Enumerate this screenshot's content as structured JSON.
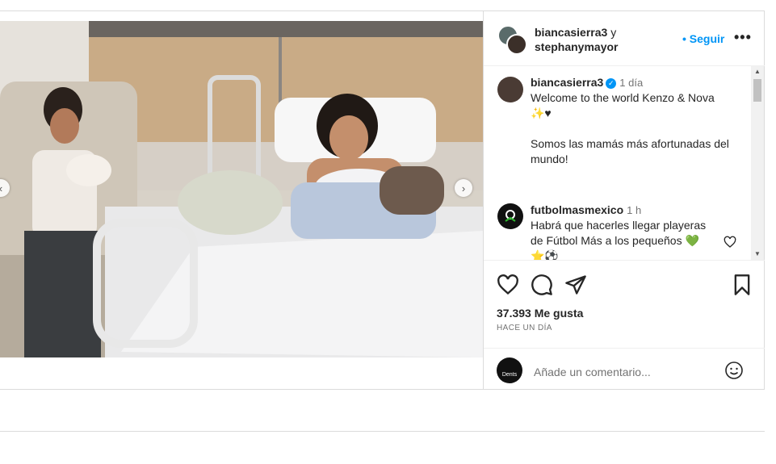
{
  "header": {
    "author1": "biancasierra3",
    "joiner": "y",
    "author2": "stephanymayor",
    "follow_label": "Seguir",
    "follow_dot": "•",
    "more_label": "•••"
  },
  "caption": {
    "user": "biancasierra3",
    "time": "1 día",
    "line1": "Welcome to the world Kenzo & Nova",
    "emoji1": "✨♥",
    "line2": "Somos las mamás más afortunadas del mundo!"
  },
  "comments": [
    {
      "user": "futbolmasmexico",
      "time": "1 h",
      "text": "Habrá que hacerles llegar playeras de Fútbol Más a los pequeños 💚",
      "emoji": "⭐⚽"
    }
  ],
  "engagement": {
    "likes": "37.393 Me gusta",
    "timestamp": "HACE UN DÍA"
  },
  "composer": {
    "placeholder": "Añade un comentario...",
    "avatar_text": "Dents"
  },
  "icons": {
    "like": "heart-icon",
    "comment": "comment-icon",
    "share": "send-icon",
    "save": "bookmark-icon",
    "emoji": "emoji-icon",
    "verified": "verified-icon"
  },
  "colors": {
    "accent": "#0095f6",
    "text": "#262626",
    "muted": "#737373",
    "heart_green": "#2db82d"
  }
}
